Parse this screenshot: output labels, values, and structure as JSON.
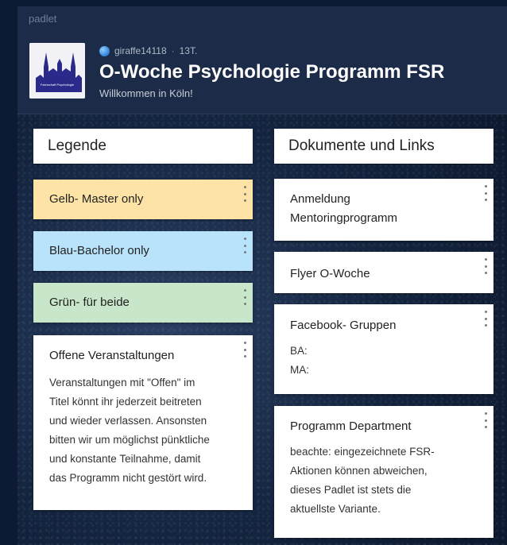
{
  "app": {
    "brand": "padlet"
  },
  "board": {
    "author": "giraffe14118",
    "age": "13T.",
    "title": "O-Woche Psychologie Programm FSR",
    "subtitle": "Willkommen in Köln!",
    "logo_text": "Fachschaft Psychologie"
  },
  "columns": [
    {
      "heading": "Legende",
      "cards": [
        {
          "title": "Gelb- Master only",
          "color": "#fde4a6"
        },
        {
          "title": "Blau-Bachelor only",
          "color": "#b8e3fb"
        },
        {
          "title": "Grün- für beide",
          "color": "#c8e6c9"
        },
        {
          "title": "Offene Veranstaltungen",
          "color": "#ffffff",
          "body_lines": [
            "Veranstaltungen mit \"Offen\" im",
            "Titel könnt ihr jederzeit beitreten",
            "und wieder verlassen. Ansonsten",
            "bitten wir um möglichst pünktliche",
            "und konstante Teilnahme, damit",
            "das Programm nicht gestört wird."
          ]
        }
      ]
    },
    {
      "heading": "Dokumente und Links",
      "cards": [
        {
          "title_lines": [
            "Anmeldung",
            "Mentoringprogramm"
          ],
          "color": "#ffffff"
        },
        {
          "title": "Flyer O-Woche",
          "color": "#ffffff"
        },
        {
          "title": "Facebook- Gruppen",
          "color": "#ffffff",
          "body_lines": [
            "BA:",
            "MA:"
          ]
        },
        {
          "title": "Programm Department",
          "color": "#ffffff",
          "body_lines": [
            "beachte: eingezeichnete FSR-",
            "Aktionen können abweichen,",
            "dieses Padlet ist stets die",
            "aktuellste Variante."
          ]
        }
      ]
    }
  ],
  "icons": {
    "globe": "globe-icon",
    "card_menu": "more-vertical-icon"
  }
}
